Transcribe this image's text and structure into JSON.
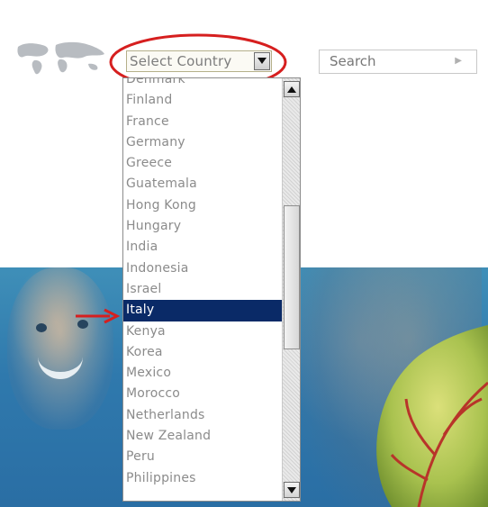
{
  "header": {
    "country_select_value": "Select Country",
    "search_label": "Search"
  },
  "country_dropdown": {
    "options": [
      {
        "label": "Denmark",
        "selected": false
      },
      {
        "label": "Finland",
        "selected": false
      },
      {
        "label": "France",
        "selected": false
      },
      {
        "label": "Germany",
        "selected": false
      },
      {
        "label": "Greece",
        "selected": false
      },
      {
        "label": "Guatemala",
        "selected": false
      },
      {
        "label": "Hong Kong",
        "selected": false
      },
      {
        "label": "Hungary",
        "selected": false
      },
      {
        "label": "India",
        "selected": false
      },
      {
        "label": "Indonesia",
        "selected": false
      },
      {
        "label": "Israel",
        "selected": false
      },
      {
        "label": "Italy",
        "selected": true
      },
      {
        "label": "Kenya",
        "selected": false
      },
      {
        "label": "Korea",
        "selected": false
      },
      {
        "label": "Mexico",
        "selected": false
      },
      {
        "label": "Morocco",
        "selected": false
      },
      {
        "label": "Netherlands",
        "selected": false
      },
      {
        "label": "New Zealand",
        "selected": false
      },
      {
        "label": "Peru",
        "selected": false
      },
      {
        "label": "Philippines",
        "selected": false
      }
    ]
  },
  "icons": {
    "select_arrow": "triangle-down-icon",
    "search_caret": "caret-right-icon",
    "scroll_up": "triangle-up-icon",
    "scroll_down": "triangle-down-icon",
    "map": "world-map-icon",
    "annotation_arrow": "red-arrow-icon"
  },
  "colors": {
    "selected_row": "#0a2a67",
    "annotation": "#d61f1f",
    "banner": "#2f79ad"
  }
}
